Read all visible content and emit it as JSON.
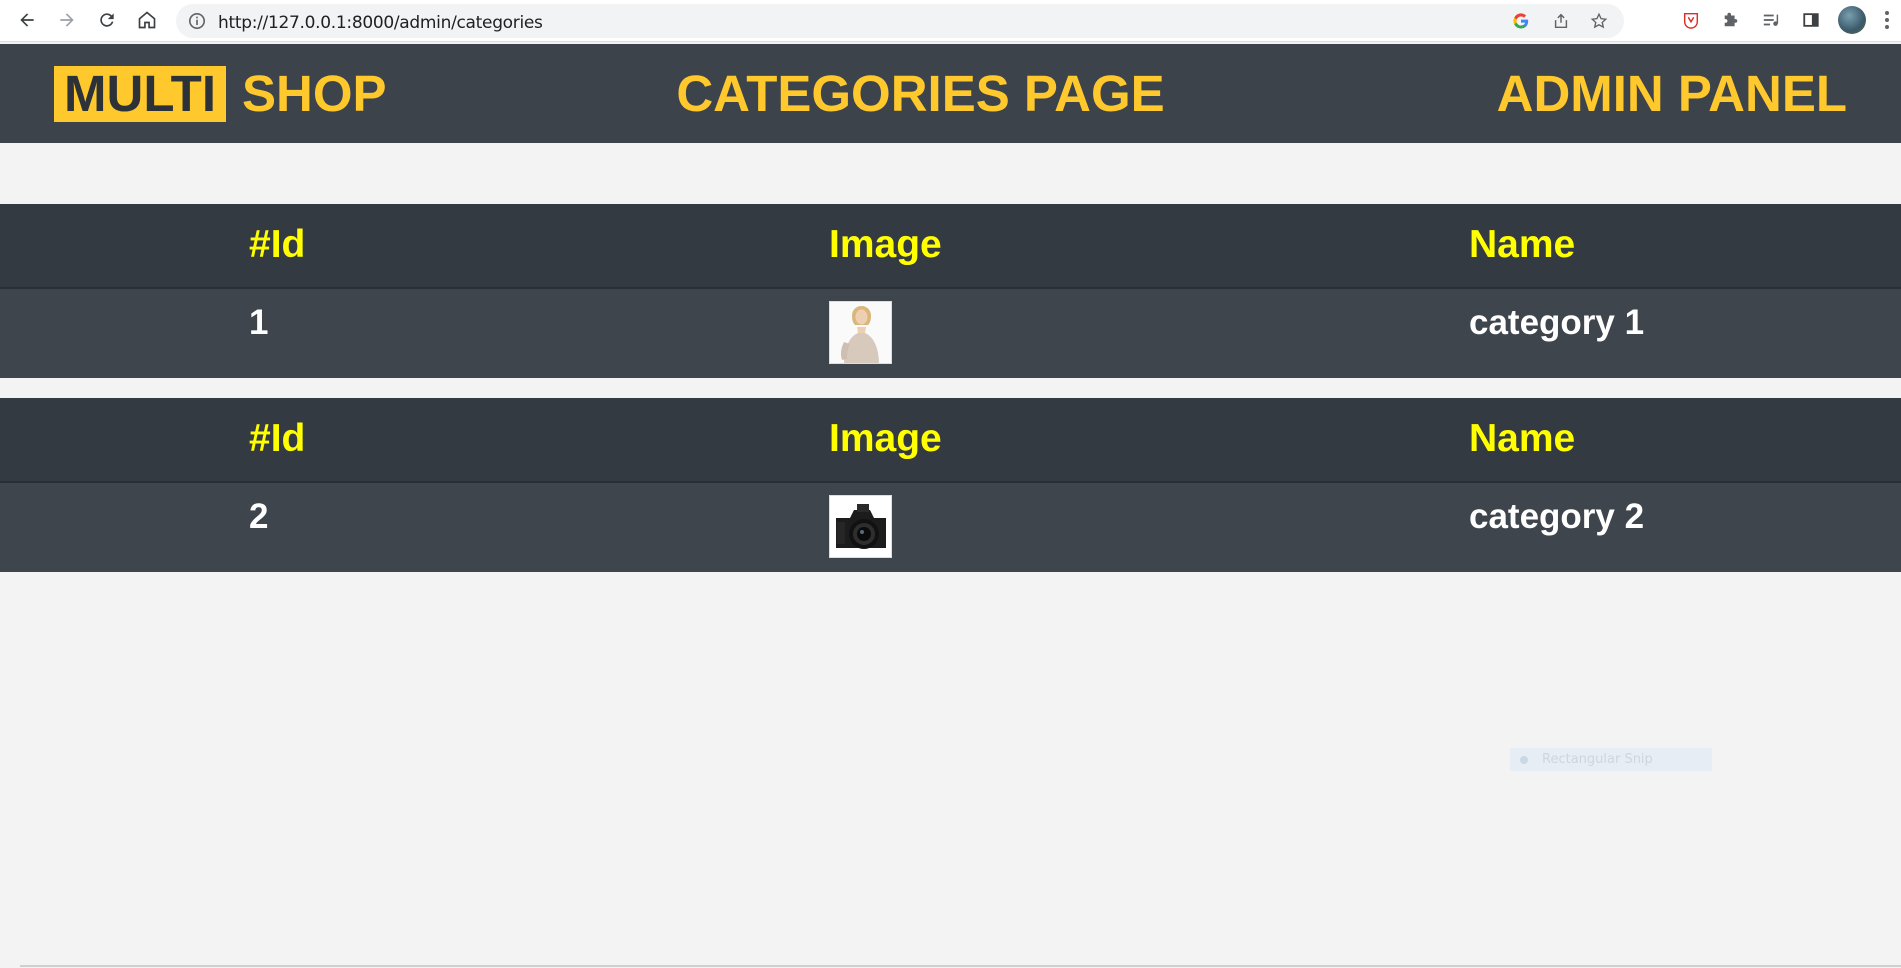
{
  "browser": {
    "url": "http://127.0.0.1:8000/admin/categories",
    "icons": [
      "back-icon",
      "forward-icon",
      "reload-icon",
      "home-icon",
      "info-icon",
      "google-icon",
      "share-icon",
      "star-icon",
      "extension-shield-icon",
      "extensions-puzzle-icon",
      "reading-list-icon",
      "side-panel-icon",
      "profile-avatar",
      "menu-kebab-icon"
    ]
  },
  "header": {
    "logo_box": "MULTI",
    "logo_text": "SHOP",
    "title": "CATEGORIES PAGE",
    "admin": "ADMIN PANEL",
    "accent_color": "#ffc82c",
    "background_color": "#3d434a"
  },
  "tables": {
    "headers": {
      "id": "#Id",
      "image": "Image",
      "name": "Name"
    },
    "header_color": "#ffff00",
    "rows": [
      {
        "id": "1",
        "image": "woman-sweater-photo",
        "name": "category 1"
      },
      {
        "id": "2",
        "image": "camera-photo",
        "name": "category 2"
      }
    ]
  },
  "overlay": {
    "snip_label": "Rectangular Snip"
  }
}
